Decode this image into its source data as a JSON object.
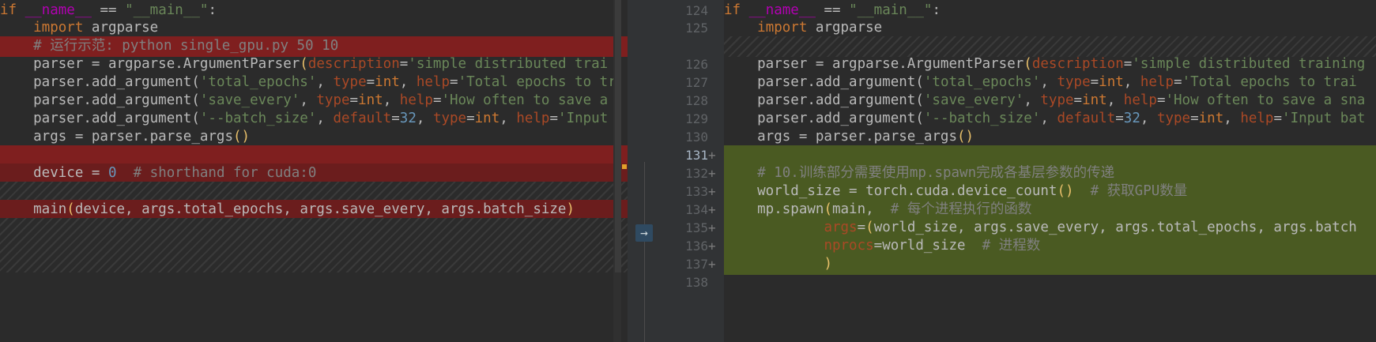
{
  "left": {
    "lines": [
      {
        "t": "if",
        "c": "kw"
      },
      {
        "t": "import",
        "c": "kw"
      },
      {
        "t": "# 运行示范: python single_gpu.py 50 10",
        "c": "cmt"
      },
      {
        "t": "parser = argparse.ArgumentParser(description='simple distributed trai",
        "c": "def"
      },
      {
        "t": "parser.add_argument('total_epochs', type=int, help='Total epochs to tr",
        "c": "def"
      },
      {
        "t": "parser.add_argument('save_every', type=int, help='How often to save a",
        "c": "def"
      },
      {
        "t": "parser.add_argument('--batch_size', default=32, type=int, help='Input",
        "c": "def"
      },
      {
        "t": "args = parser.parse_args()",
        "c": "def"
      },
      {
        "t": "device = 0  # shorthand for cuda:0",
        "c": "def"
      },
      {
        "t": "main(device, args.total_epochs, args.save_every, args.batch_size)",
        "c": "def"
      }
    ],
    "first_line": "if __name__ == \"__main__\":",
    "import_line": "import argparse"
  },
  "right": {
    "line_numbers": [
      "124",
      "125",
      "126",
      "127",
      "128",
      "129",
      "130",
      "131",
      "132",
      "133",
      "134",
      "135",
      "136",
      "137",
      "138"
    ],
    "plus_marks": [
      "+",
      "+",
      "+",
      "+",
      "+",
      "+",
      "+"
    ],
    "first_line": "if __name__ == \"__main__\":",
    "import_line": "import argparse",
    "l126": "parser = argparse.ArgumentParser(description='simple distributed training",
    "l127": "parser.add_argument('total_epochs', type=int, help='Total epochs to trai",
    "l128": "parser.add_argument('save_every', type=int, help='How often to save a sna",
    "l129": "parser.add_argument('--batch_size', default=32, type=int, help='Input bat",
    "l130": "args = parser.parse_args()",
    "l132": "# 10.训练部分需要使用mp.spawn完成各基层参数的传递",
    "l133": "world_size = torch.cuda.device_count()  # 获取GPU数量",
    "l134": "mp.spawn(main,  # 每个进程执行的函数",
    "l135": "args=(world_size, args.save_every, args.total_epochs, args.batch",
    "l136": "nprocs=world_size  # 进程数",
    "l137": ")"
  },
  "divider": {
    "apply_icon": "→"
  }
}
